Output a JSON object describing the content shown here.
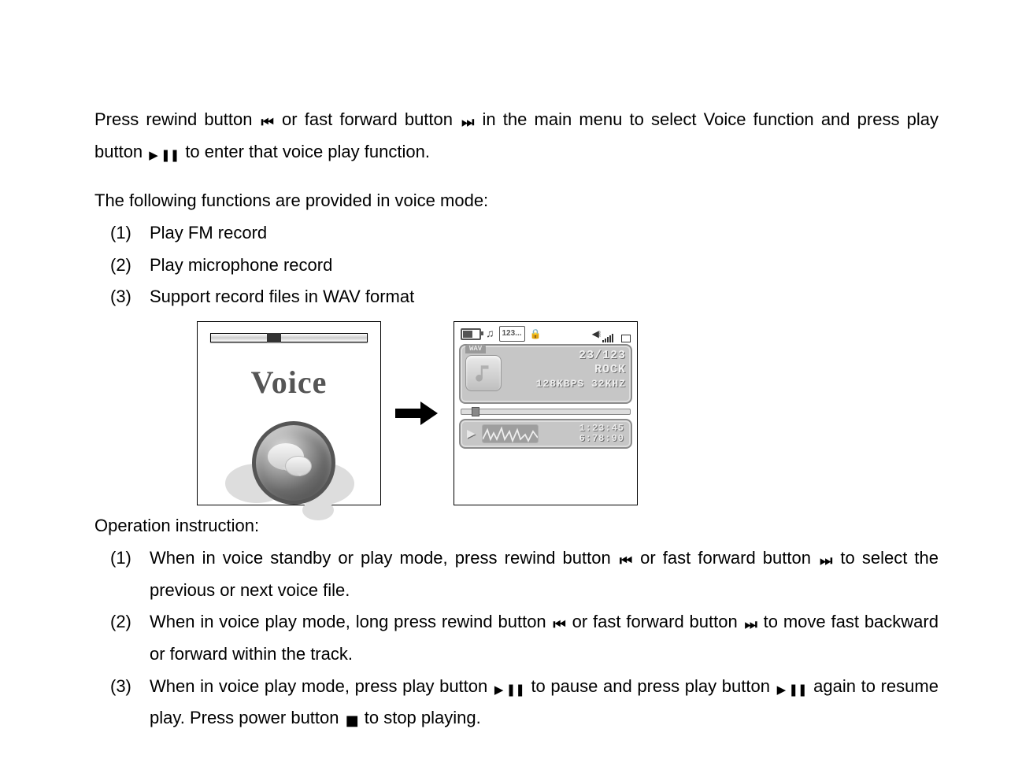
{
  "intro": {
    "p1a": "Press rewind button ",
    "p1b": " or fast forward button ",
    "p1c": " in the main menu to select Voice function and press play button ",
    "p1d": " to enter that voice play function.",
    "p2": "The following functions are provided in voice mode:"
  },
  "func_list": [
    {
      "num": "(1)",
      "text": "Play FM record"
    },
    {
      "num": "(2)",
      "text": "Play microphone record"
    },
    {
      "num": "(3)",
      "text": "Support record files in WAV format"
    }
  ],
  "op_heading": "Operation instruction:",
  "op_list": [
    {
      "num": "(1)",
      "a": "When in voice standby or play mode, press rewind button ",
      "b": " or fast forward button",
      "c": " to select the previous or next voice file."
    },
    {
      "num": "(2)",
      "a": "When in voice play mode, long press rewind button ",
      "b": " or fast forward button ",
      "c": " to move fast backward or forward within the track."
    },
    {
      "num": "(3)",
      "a": "When in voice play mode, press play button ",
      "b": " to pause and press play button ",
      "c": " again to resume play. Press power button ",
      "d": " to stop playing."
    }
  ],
  "icons": {
    "rewind": "⏮",
    "forward": "⏭",
    "playpause": "▶ ❚❚",
    "stop": "■"
  },
  "menu_screen": {
    "title": "Voice"
  },
  "play_screen": {
    "status": {
      "folder_label": "123..."
    },
    "file_tag": "WAV",
    "track_index": "23/123",
    "eq_mode": "ROCK",
    "codec": "128KBPS 32KHZ",
    "time_elapsed": "1:23:45",
    "time_total": "6:78:90"
  }
}
